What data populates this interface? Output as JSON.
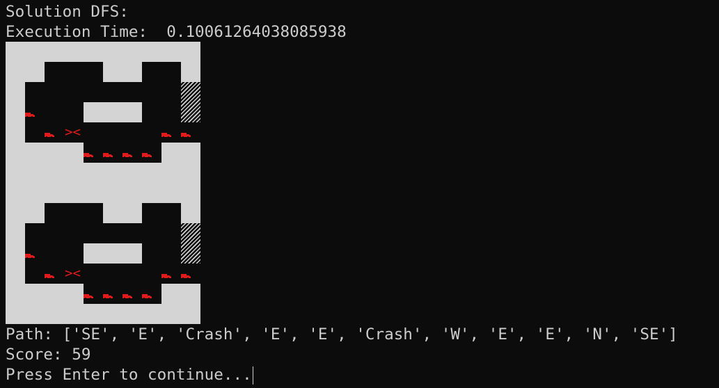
{
  "terminal": {
    "solution_line": "Solution DFS:",
    "execution_line": "Execution Time:  0.10061264038085938",
    "path_line": "Path: ['SE', 'E', 'Crash', 'E', 'E', 'Crash', 'W', 'E', 'E', 'N', 'SE']",
    "score_line": "Score: 59",
    "prompt_line": "Press Enter to continue..."
  },
  "board": {
    "crash_symbol": "><",
    "car_icon": "red-car-icon",
    "finish_icon": "hatched-finish-icon",
    "colors": {
      "background": "#0c0c0c",
      "wall": "#d4d4d4",
      "car": "#e01b1b",
      "text": "#cccccc"
    }
  }
}
